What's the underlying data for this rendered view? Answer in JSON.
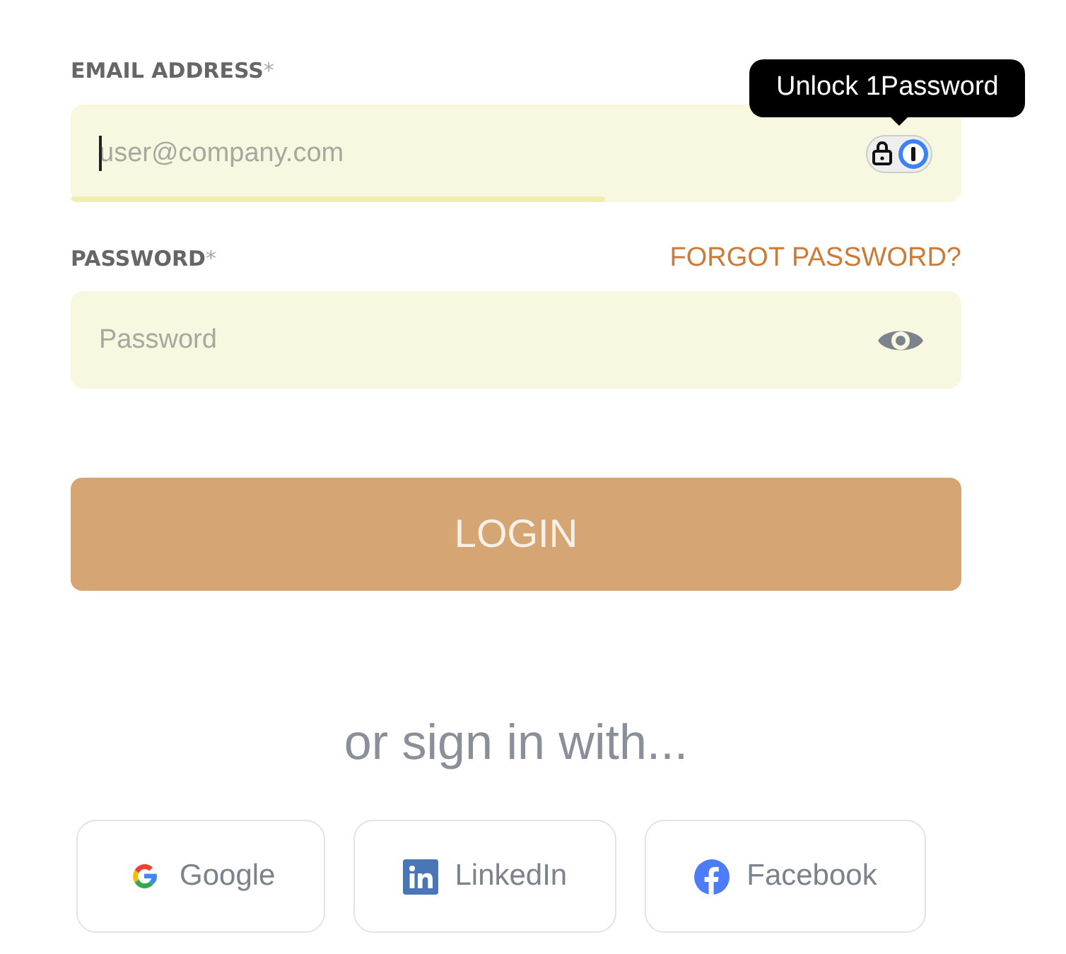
{
  "email": {
    "label": "EMAIL ADDRESS",
    "asterisk": "*",
    "placeholder": "user@company.com",
    "focused": true,
    "level": 0.6
  },
  "tooltip": {
    "text": "Unlock 1Password"
  },
  "password": {
    "label": "PASSWORD",
    "asterisk": "*",
    "placeholder": "Password",
    "forgot_link": "FORGOT PASSWORD?"
  },
  "login_button": "LOGIN",
  "divider_text": "or sign in with...",
  "social_buttons": [
    {
      "kind": "google",
      "label": "Google"
    },
    {
      "kind": "linkedin",
      "label": "LinkedIn"
    },
    {
      "kind": "facebook",
      "label": "Facebook"
    }
  ]
}
